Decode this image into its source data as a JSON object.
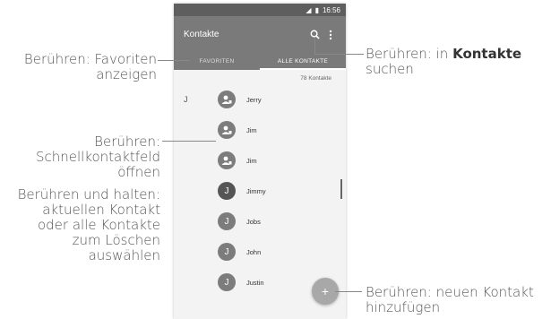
{
  "statusbar": {
    "time": "16:56"
  },
  "appbar": {
    "title": "Kontakte"
  },
  "tabs": [
    {
      "label": "FAVORITEN"
    },
    {
      "label": "ALLE KONTAKTE"
    }
  ],
  "contact_count": "78 Kontakte",
  "section_letter": "J",
  "contacts": [
    {
      "name": "Jerry",
      "avatar": "person-icon"
    },
    {
      "name": "Jim",
      "avatar": "person-icon"
    },
    {
      "name": "Jim",
      "avatar": "person-icon"
    },
    {
      "name": "Jimmy",
      "initial": "J"
    },
    {
      "name": "Jobs",
      "initial": "J"
    },
    {
      "name": "John",
      "initial": "J"
    },
    {
      "name": "Justin",
      "initial": "J"
    }
  ],
  "fab": {
    "symbol": "+"
  },
  "callouts": {
    "favorites_line1": "Berühren: Favoriten",
    "favorites_line2": "anzeigen",
    "search_prefix": "Berühren: in ",
    "search_bold": "Kontakte",
    "search_line2": "suchen",
    "quick_line1": "Berühren:",
    "quick_line2": "Schnellkontaktfeld",
    "quick_line3": "öffnen",
    "hold_line1": "Berühren und halten:",
    "hold_line2": "aktuellen Kontakt",
    "hold_line3": "oder alle Kontakte",
    "hold_line4": "zum Löschen",
    "hold_line5": "auswählen",
    "add_line1": "Berühren: neuen Kontakt",
    "add_line2": "hinzufügen"
  },
  "colors": {
    "appbar": "#7a7a7a",
    "statusbar": "#5e5e5e",
    "background": "#f3f3f3",
    "fab": "#a8a8a8"
  }
}
